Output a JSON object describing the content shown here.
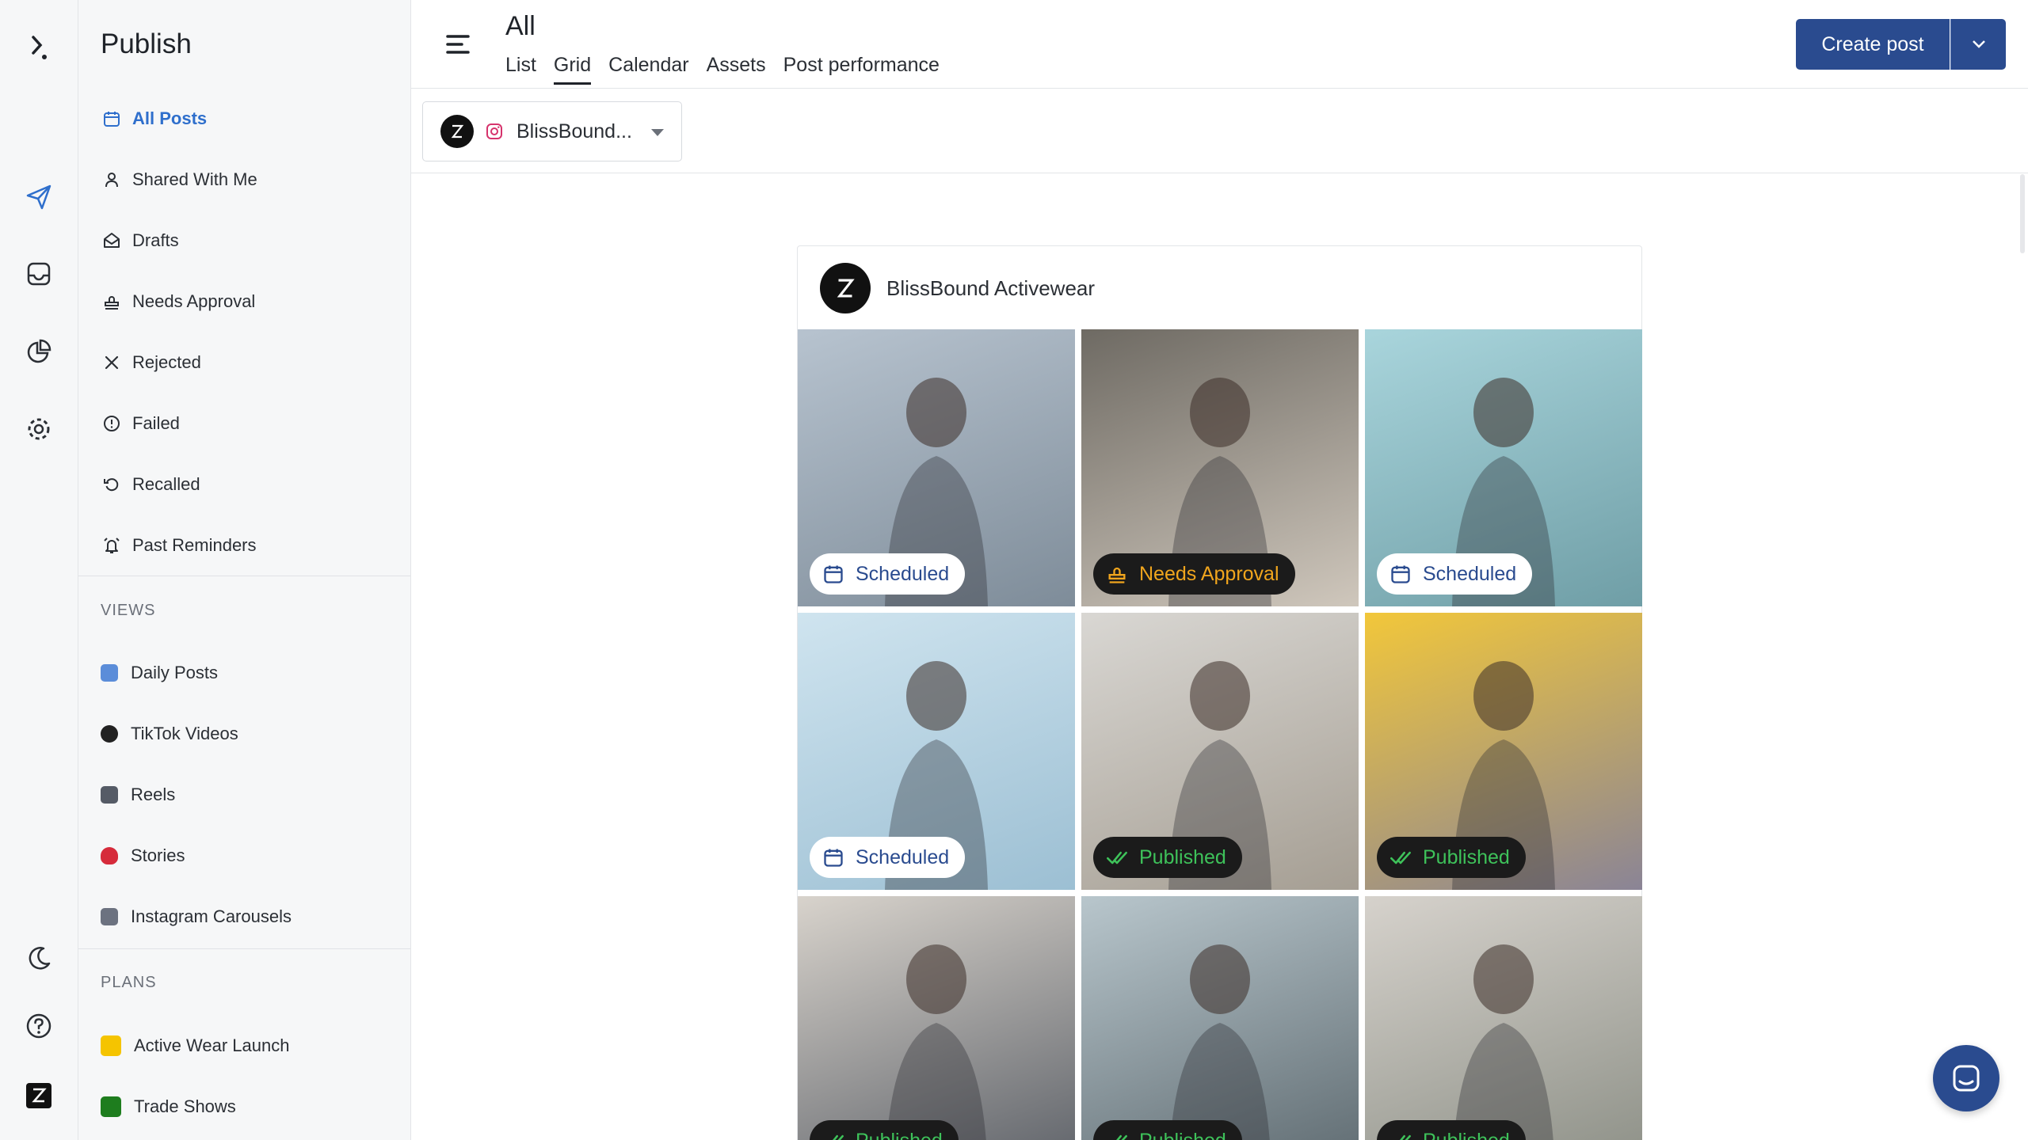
{
  "app": {
    "section_title": "Publish"
  },
  "rail": [
    "logo-icon",
    "send-icon",
    "inbox-icon",
    "analytics-icon",
    "settings-icon",
    "moon-icon",
    "help-icon",
    "workspace-icon"
  ],
  "nav": [
    {
      "label": "All Posts",
      "icon": "calendar-icon",
      "active": true
    },
    {
      "label": "Shared With Me",
      "icon": "person-icon"
    },
    {
      "label": "Drafts",
      "icon": "drafts-icon"
    },
    {
      "label": "Needs Approval",
      "icon": "stamp-icon"
    },
    {
      "label": "Rejected",
      "icon": "x-icon"
    },
    {
      "label": "Failed",
      "icon": "alert-icon"
    },
    {
      "label": "Recalled",
      "icon": "undo-icon"
    },
    {
      "label": "Past Reminders",
      "icon": "alarm-icon"
    }
  ],
  "views": {
    "label": "VIEWS",
    "items": [
      {
        "label": "Daily Posts",
        "color": "#5b8dd9"
      },
      {
        "label": "TikTok Videos",
        "color": "#222222"
      },
      {
        "label": "Reels",
        "color": "#555b66"
      },
      {
        "label": "Stories",
        "color": "#d62b3b"
      },
      {
        "label": "Instagram Carousels",
        "color": "#6c7280"
      }
    ]
  },
  "plans": {
    "label": "PLANS",
    "items": [
      {
        "label": "Active Wear Launch",
        "color": "#f5c400"
      },
      {
        "label": "Trade Shows",
        "color": "#1e7d1e"
      }
    ]
  },
  "header": {
    "title": "All",
    "tabs": [
      {
        "label": "List"
      },
      {
        "label": "Grid",
        "active": true
      },
      {
        "label": "Calendar"
      },
      {
        "label": "Assets"
      },
      {
        "label": "Post performance"
      }
    ],
    "create_label": "Create post"
  },
  "filter": {
    "account_label": "BlissBound..."
  },
  "grid": {
    "account_name": "BlissBound Activewear",
    "posts": [
      {
        "status": "Scheduled",
        "kind": "scheduled",
        "bg": [
          "#b7c3cf",
          "#7e8c99"
        ]
      },
      {
        "status": "Needs Approval",
        "kind": "approval",
        "bg": [
          "#6e6a63",
          "#cfc7bc"
        ]
      },
      {
        "status": "Scheduled",
        "kind": "scheduled",
        "bg": [
          "#a9d5dc",
          "#6f9ea6"
        ]
      },
      {
        "status": "Scheduled",
        "kind": "scheduled",
        "bg": [
          "#cfe4ef",
          "#9cbfd3"
        ]
      },
      {
        "status": "Published",
        "kind": "published",
        "bg": [
          "#d9d7d3",
          "#a59e93"
        ]
      },
      {
        "status": "Published",
        "kind": "published",
        "bg": [
          "#f2c73a",
          "#8a8496"
        ]
      },
      {
        "status": "Published",
        "kind": "published",
        "bg": [
          "#d8d3cc",
          "#5d6168"
        ]
      },
      {
        "status": "Published",
        "kind": "published",
        "bg": [
          "#b8c6cc",
          "#5e6a70"
        ]
      },
      {
        "status": "Published",
        "kind": "published",
        "bg": [
          "#d6d2cc",
          "#8c8f86"
        ]
      }
    ]
  }
}
